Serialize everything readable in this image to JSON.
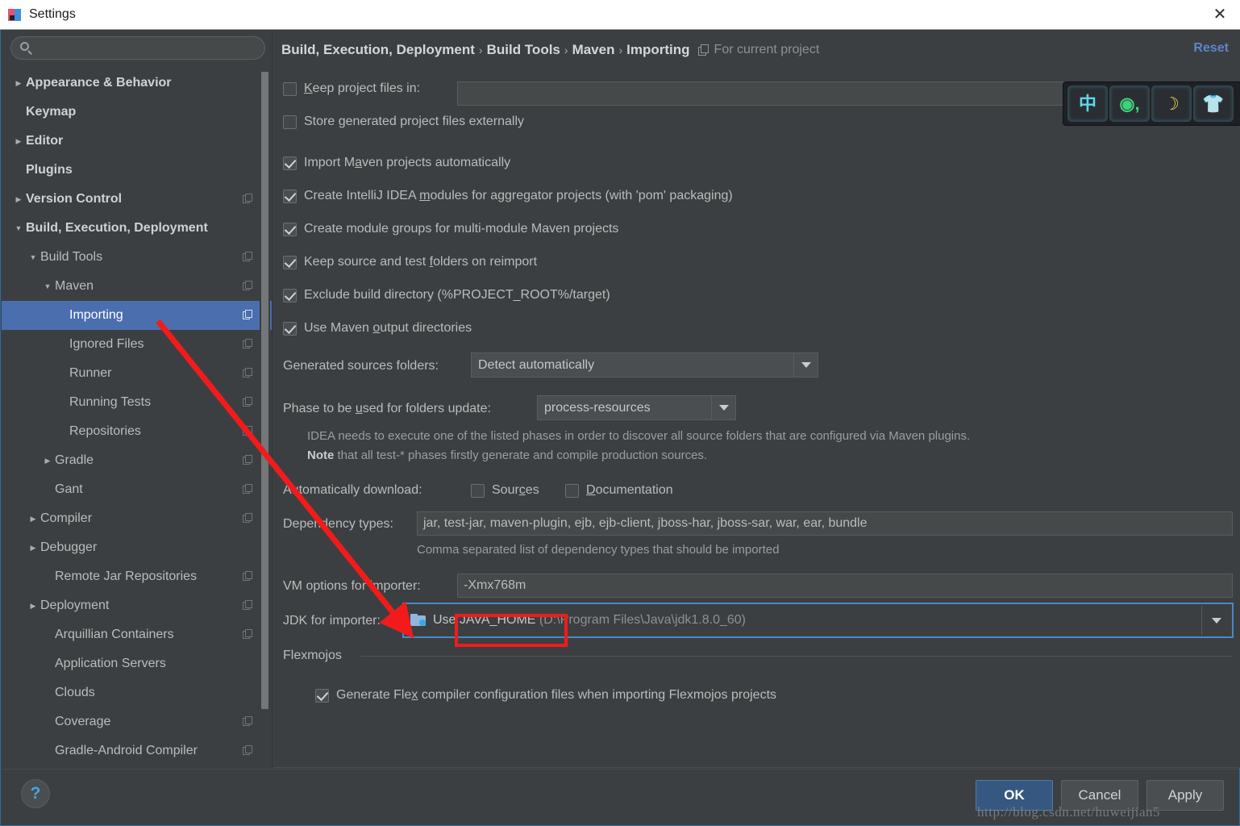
{
  "window": {
    "title": "Settings",
    "close_label": "✕",
    "app_icon": "intellij-idea-icon"
  },
  "sidebar": {
    "search": {
      "placeholder": "",
      "value": "",
      "icon": "search-icon"
    },
    "items": [
      {
        "label": "Appearance & Behavior",
        "level": 0,
        "arrow": "▶",
        "selected": false,
        "project_mark": false
      },
      {
        "label": "Keymap",
        "level": 0,
        "arrow": "",
        "selected": false,
        "project_mark": false
      },
      {
        "label": "Editor",
        "level": 0,
        "arrow": "▶",
        "selected": false,
        "project_mark": false
      },
      {
        "label": "Plugins",
        "level": 0,
        "arrow": "",
        "selected": false,
        "project_mark": false
      },
      {
        "label": "Version Control",
        "level": 0,
        "arrow": "▶",
        "selected": false,
        "project_mark": true
      },
      {
        "label": "Build, Execution, Deployment",
        "level": 0,
        "arrow": "▼",
        "selected": false,
        "project_mark": false
      },
      {
        "label": "Build Tools",
        "level": 1,
        "arrow": "▼",
        "selected": false,
        "project_mark": true
      },
      {
        "label": "Maven",
        "level": 2,
        "arrow": "▼",
        "selected": false,
        "project_mark": true
      },
      {
        "label": "Importing",
        "level": 3,
        "arrow": "",
        "selected": true,
        "project_mark": true
      },
      {
        "label": "Ignored Files",
        "level": 3,
        "arrow": "",
        "selected": false,
        "project_mark": true
      },
      {
        "label": "Runner",
        "level": 3,
        "arrow": "",
        "selected": false,
        "project_mark": true
      },
      {
        "label": "Running Tests",
        "level": 3,
        "arrow": "",
        "selected": false,
        "project_mark": true
      },
      {
        "label": "Repositories",
        "level": 3,
        "arrow": "",
        "selected": false,
        "project_mark": true
      },
      {
        "label": "Gradle",
        "level": 2,
        "arrow": "▶",
        "selected": false,
        "project_mark": true
      },
      {
        "label": "Gant",
        "level": 2,
        "arrow": "",
        "selected": false,
        "project_mark": true
      },
      {
        "label": "Compiler",
        "level": 1,
        "arrow": "▶",
        "selected": false,
        "project_mark": true
      },
      {
        "label": "Debugger",
        "level": 1,
        "arrow": "▶",
        "selected": false,
        "project_mark": false
      },
      {
        "label": "Remote Jar Repositories",
        "level": 2,
        "arrow": "",
        "selected": false,
        "project_mark": true
      },
      {
        "label": "Deployment",
        "level": 1,
        "arrow": "▶",
        "selected": false,
        "project_mark": true
      },
      {
        "label": "Arquillian Containers",
        "level": 2,
        "arrow": "",
        "selected": false,
        "project_mark": true
      },
      {
        "label": "Application Servers",
        "level": 2,
        "arrow": "",
        "selected": false,
        "project_mark": false
      },
      {
        "label": "Clouds",
        "level": 2,
        "arrow": "",
        "selected": false,
        "project_mark": false
      },
      {
        "label": "Coverage",
        "level": 2,
        "arrow": "",
        "selected": false,
        "project_mark": true
      },
      {
        "label": "Gradle-Android Compiler",
        "level": 2,
        "arrow": "",
        "selected": false,
        "project_mark": true
      }
    ]
  },
  "header": {
    "crumb1": "Build, Execution, Deployment",
    "crumb2": "Build Tools",
    "crumb3": "Maven",
    "crumb4": "Importing",
    "separator": "›",
    "scope_label": "For current project",
    "scope_icon": "project-scope-icon",
    "reset_label": "Reset"
  },
  "form": {
    "keep_project_files": {
      "label": "Keep project files in:",
      "mnemonic": "K",
      "checked": false,
      "value": ""
    },
    "store_generated": {
      "label": "Store generated project files externally",
      "checked": false
    },
    "import_auto": {
      "label_pre": "Import M",
      "mnemonic": "a",
      "label_post": "ven projects automatically",
      "checked": true
    },
    "create_modules": {
      "label_pre": "Create IntelliJ IDEA ",
      "mnemonic": "m",
      "label_post": "odules for aggregator projects (with 'pom' packaging)",
      "checked": true
    },
    "create_groups": {
      "label_pre": "Create module ",
      "mnemonic": "g",
      "label_post": "roups for multi-module Maven projects",
      "checked": true
    },
    "keep_source": {
      "label_pre": "Keep source and test ",
      "mnemonic": "f",
      "label_post": "olders on reimport",
      "checked": true
    },
    "exclude_build": {
      "label": "Exclude build directory (%PROJECT_ROOT%/target)",
      "checked": true
    },
    "use_output": {
      "label_pre": "Use Maven ",
      "mnemonic": "o",
      "label_post": "utput directories",
      "checked": true
    },
    "generated_sources": {
      "label": "Generated sources folders:",
      "value": "Detect automatically"
    },
    "phase": {
      "label_pre": "Phase to be ",
      "mnemonic": "u",
      "label_post": "sed for folders update:",
      "value": "process-resources"
    },
    "note_line1": "IDEA needs to execute one of the listed phases in order to discover all source folders that are configured via Maven plugins.",
    "note_bold": "Note",
    "note_line2": " that all test-* phases firstly generate and compile production sources.",
    "auto_download": {
      "label": "Automatically download:"
    },
    "sources": {
      "label_pre": "Sour",
      "mnemonic": "c",
      "label_post": "es",
      "checked": false
    },
    "documentation": {
      "label_pre": "",
      "mnemonic": "D",
      "label_post": "ocumentation",
      "checked": false
    },
    "dependency_types": {
      "label": "Dependency types:",
      "value": "jar, test-jar, maven-plugin, ejb, ejb-client, jboss-har, jboss-sar, war, ear, bundle",
      "hint": "Comma separated list of dependency types that should be imported"
    },
    "vm_options": {
      "label": "VM options for importer:",
      "value": "-Xmx768m"
    },
    "jdk": {
      "label": "JDK for importer:",
      "icon": "folder-icon",
      "value_prefix": "Use ",
      "value_highlight": "JAVA_HOME",
      "value_path": " (D:\\Program Files\\Java\\jdk1.8.0_60)"
    },
    "flexmojos": {
      "group_label": "Flexmojos",
      "generate_flex": {
        "label_pre": "Generate Fle",
        "mnemonic": "x",
        "label_post": " compiler configuration files when importing Flexmojos projects",
        "checked": true
      }
    }
  },
  "ime": {
    "keys": [
      {
        "name": "chinese-mode-icon",
        "glyph": "中",
        "style": "g-cn"
      },
      {
        "name": "punctuation-mode-icon",
        "glyph": "୦,",
        "style": "g-pn"
      },
      {
        "name": "moon-icon",
        "glyph": "☽",
        "style": "g-mn"
      },
      {
        "name": "skin-icon",
        "glyph": "\u0001",
        "style": "g-sk"
      }
    ]
  },
  "footer": {
    "help_label": "?",
    "ok_label": "OK",
    "cancel_label": "Cancel",
    "apply_label": "Apply",
    "watermark": "http://blog.csdn.net/huweijian5"
  },
  "colors": {
    "background": "#3c3f41",
    "selection": "#4b6eaf",
    "accent_link": "#5c84cf",
    "annotation_red": "#f21b1b",
    "focus_border": "#4a88c7",
    "primary_button": "#365880"
  }
}
